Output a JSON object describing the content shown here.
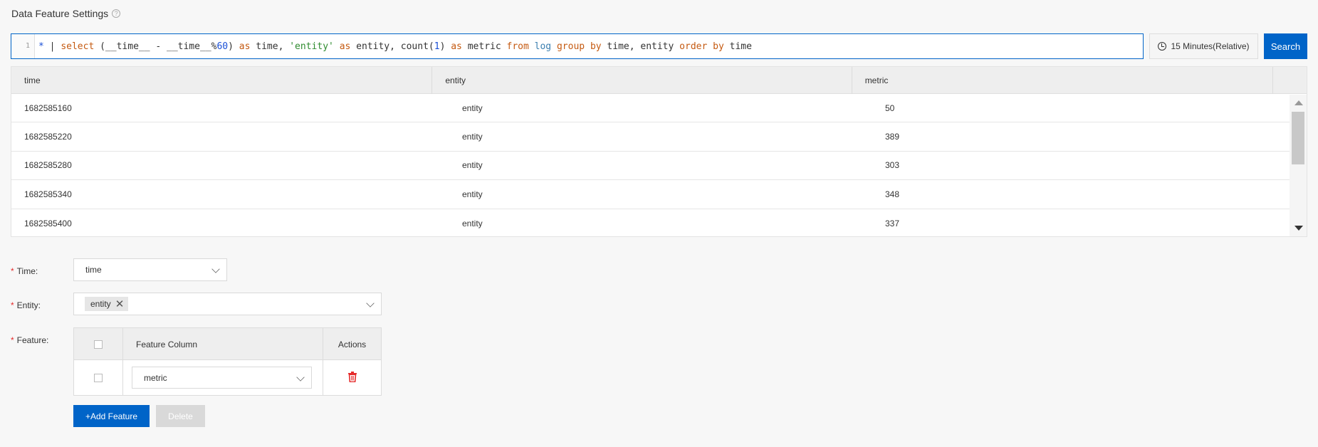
{
  "page": {
    "title": "Data Feature Settings",
    "help_icon": "?"
  },
  "query": {
    "line_number": "1",
    "parts": {
      "star": "*",
      "pipe": " | ",
      "select": "select",
      "p1": " (__time__ - __time__%",
      "n60": "60",
      "p2": ") ",
      "as1": "as",
      "p3": " time, ",
      "str_entity": "'entity'",
      "p4": " ",
      "as2": "as",
      "p5": " entity, count(",
      "n1": "1",
      "p6": ") ",
      "as3": "as",
      "p7": " metric ",
      "from": "from",
      "p8": " ",
      "log": "log",
      "p9": " ",
      "group": "group",
      "p10": " ",
      "by1": "by",
      "p11": " time, entity ",
      "order": "order",
      "p12": " ",
      "by2": "by",
      "p13": " time"
    }
  },
  "time_range": {
    "label": "15 Minutes(Relative)",
    "icon": "clock-icon"
  },
  "search_button": "Search",
  "results": {
    "columns": [
      "time",
      "entity",
      "metric"
    ],
    "rows": [
      [
        "1682585160",
        "entity",
        "50"
      ],
      [
        "1682585220",
        "entity",
        "389"
      ],
      [
        "1682585280",
        "entity",
        "303"
      ],
      [
        "1682585340",
        "entity",
        "348"
      ],
      [
        "1682585400",
        "entity",
        "337"
      ]
    ]
  },
  "form": {
    "required_mark": "*",
    "time_label": "Time:",
    "time_value": "time",
    "entity_label": "Entity:",
    "entity_tag": "entity",
    "entity_tag_close": "✕",
    "feature_label": "Feature:",
    "feature_table": {
      "col_feature": "Feature Column",
      "col_actions": "Actions",
      "rows": [
        {
          "value": "metric"
        }
      ]
    },
    "add_button": "+Add Feature",
    "delete_button": "Delete"
  },
  "colors": {
    "primary": "#0064c8",
    "required": "#e52b2b",
    "trash": "#e52b2b"
  }
}
